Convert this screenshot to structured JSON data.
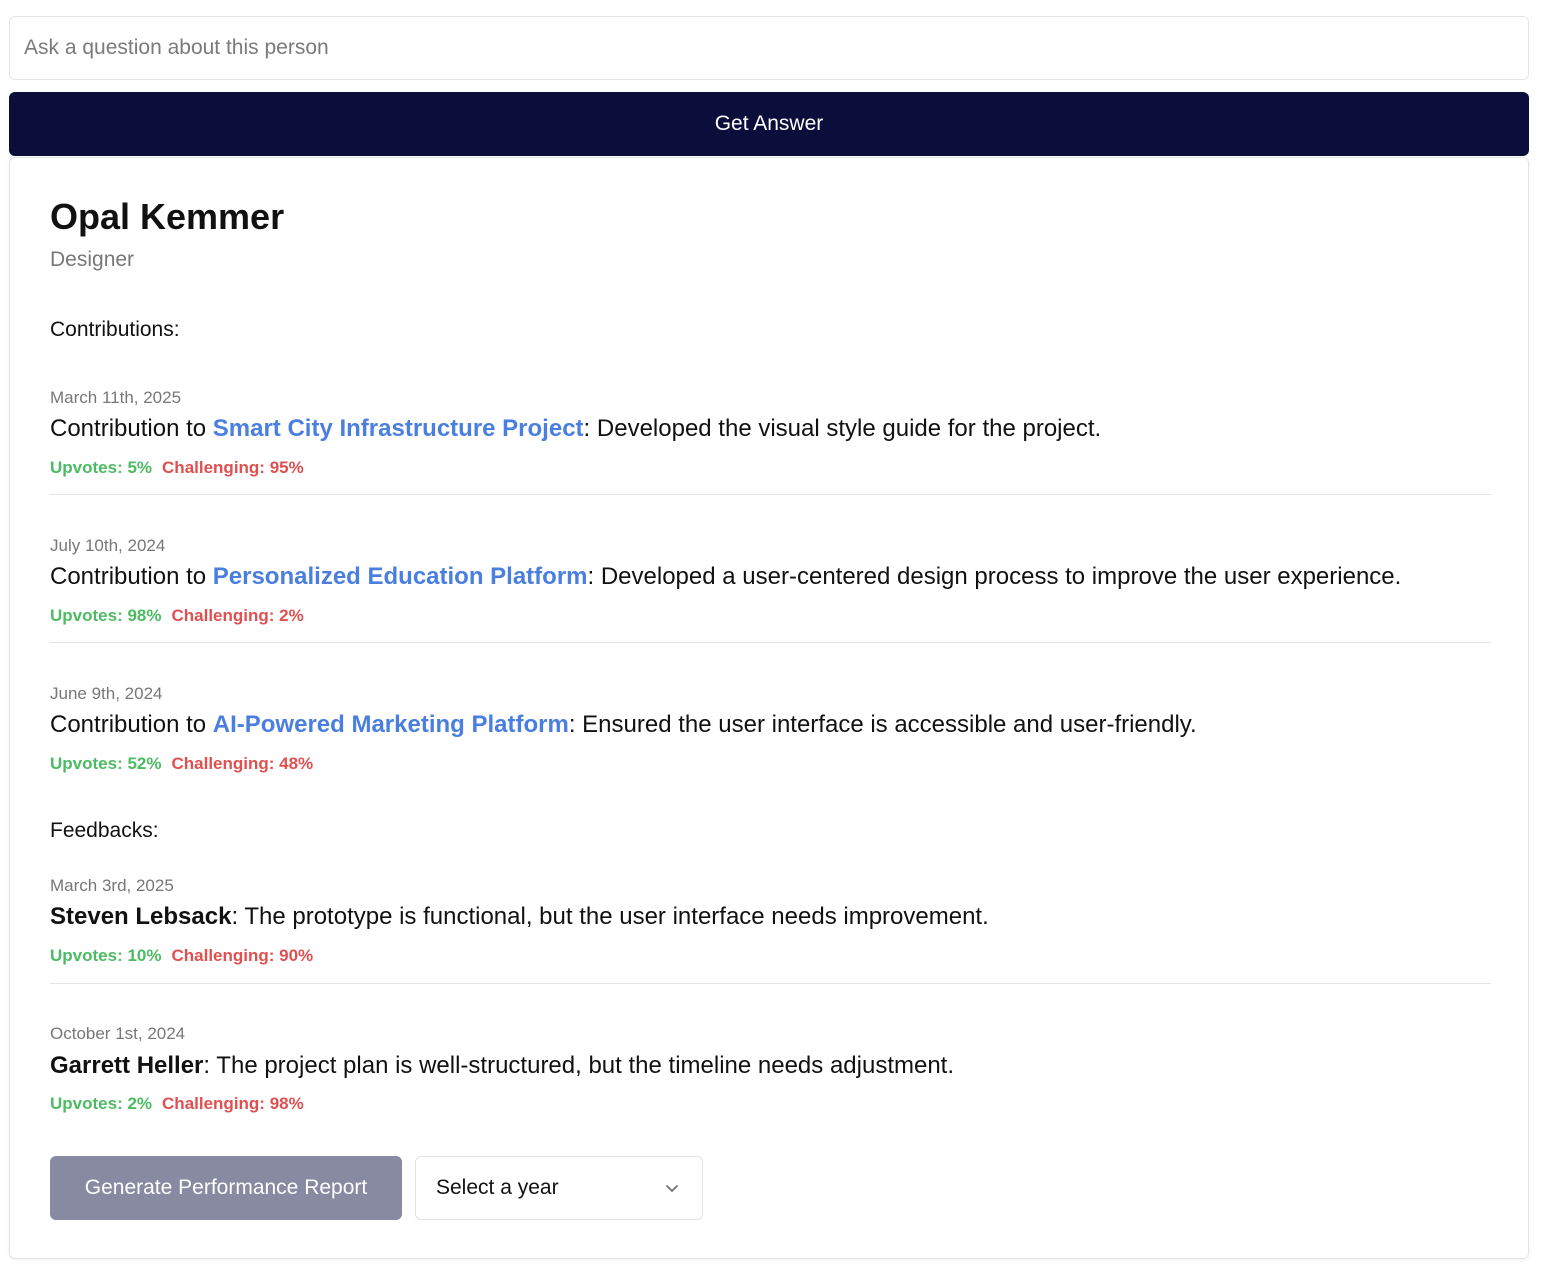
{
  "question": {
    "placeholder": "Ask a question about this person",
    "value": ""
  },
  "answer_button_label": "Get Answer",
  "person": {
    "name": "Opal Kemmer",
    "role": "Designer"
  },
  "contributions_label": "Contributions:",
  "contributions": [
    {
      "date": "March 11th, 2025",
      "prefix": "Contribution to ",
      "project": "Smart City Infrastructure Project",
      "description": ": Developed the visual style guide for the project.",
      "upvotes": "Upvotes: 5%",
      "challenging": "Challenging: 95%"
    },
    {
      "date": "July 10th, 2024",
      "prefix": "Contribution to ",
      "project": "Personalized Education Platform",
      "description": ": Developed a user-centered design process to improve the user experience.",
      "upvotes": "Upvotes: 98%",
      "challenging": "Challenging: 2%"
    },
    {
      "date": "June 9th, 2024",
      "prefix": "Contribution to ",
      "project": "AI-Powered Marketing Platform",
      "description": ": Ensured the user interface is accessible and user-friendly.",
      "upvotes": "Upvotes: 52%",
      "challenging": "Challenging: 48%"
    }
  ],
  "feedbacks_label": "Feedbacks:",
  "feedbacks": [
    {
      "date": "March 3rd, 2025",
      "author": "Steven Lebsack",
      "text": ": The prototype is functional, but the user interface needs improvement.",
      "upvotes": "Upvotes: 10%",
      "challenging": "Challenging: 90%"
    },
    {
      "date": "October 1st, 2024",
      "author": "Garrett Heller",
      "text": ": The project plan is well-structured, but the timeline needs adjustment.",
      "upvotes": "Upvotes: 2%",
      "challenging": "Challenging: 98%"
    }
  ],
  "report_button_label": "Generate Performance Report",
  "year_select": {
    "selected": "Select a year",
    "icon": "chevron-down-icon"
  },
  "colors": {
    "primary_button": "#0b0d3a",
    "report_button": "#878aa0",
    "link": "#4a7fe0",
    "upvotes": "#4cbb62",
    "challenging": "#e05050"
  }
}
